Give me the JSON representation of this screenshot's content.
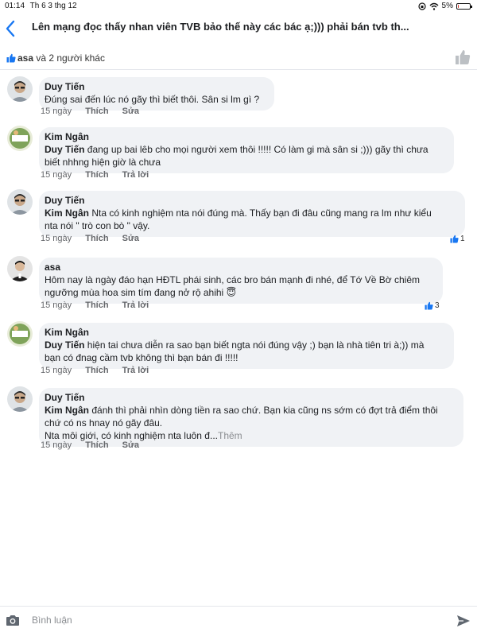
{
  "status_bar": {
    "time": "01:14",
    "date": "Th 6 3 thg 12",
    "battery": "5%",
    "battery_level": 0.05
  },
  "header": {
    "title": "Lên mạng đọc thấy nhan  viên TVB bảo thế này các bác ạ;))) phải bán tvb th..."
  },
  "likes": {
    "name": "asa",
    "others": " và 2 người khác"
  },
  "comments": [
    {
      "author": "Duy Tiến",
      "mention": "",
      "text": "Đúng sai đến lúc nó gãy thì biết thôi. Sân si lm gì ?",
      "time": "15 ngày",
      "like": "Thích",
      "action": "Sửa"
    },
    {
      "author": "Kim Ngân",
      "mention": "Duy Tiến",
      "line1": "  đang up bai lêb cho mọi người xem thôi !!!!! Có làm gi mà sân si ;))) gãy thì chưa",
      "line2": "biết nhhng hiện giờ là chưa",
      "time": "15 ngày",
      "like": "Thích",
      "action": "Trả lời"
    },
    {
      "author": "Duy Tiến",
      "mention": "Kim Ngân",
      "line1": "   Nta có kinh nghiệm nta nói đúng mà. Thấy bạn đi đâu cũng mang ra lm như kiểu",
      "line2": "nta nói \" trò con bò \" vậy.",
      "time": "15 ngày",
      "like": "Thích",
      "action": "Sửa",
      "reactions": "1"
    },
    {
      "author": "asa",
      "line1": "Hôm nay là ngày đáo hạn HĐTL phái sinh, các bro bán mạnh đi nhé, để Tớ Về Bờ chiêm",
      "line2": "ngưỡng mùa hoa sim tím đang nở rộ ahihi",
      "emoji": "😇",
      "time": "15 ngày",
      "like": "Thích",
      "action": "Trả lời",
      "reactions": "3"
    },
    {
      "author": "Kim Ngân",
      "mention": "Duy Tiến",
      "line1": "  hiện tai chưa diễn ra sao bạn biết ngta nói đúng vậy ;) bạn là nhà tiên tri à;)) mà",
      "line2": "bạn có đnag cầm tvb không thì bạn bán đi !!!!!",
      "time": "15 ngày",
      "like": "Thích",
      "action": "Trả lời"
    },
    {
      "author": "Duy Tiến",
      "mention": "Kim Ngân",
      "line1": "   đánh thì phải nhìn dòng tiền ra sao chứ. Bạn kia cũng ns sớm có đợt trả điểm thôi",
      "line2": "chứ có ns hnay nó gãy đâu.",
      "line3": "Nta môi giới, có kinh nghiệm nta luôn đ...",
      "more": "Thêm",
      "time": "15 ngày",
      "like": "Thích",
      "action": "Sửa"
    }
  ],
  "composer": {
    "placeholder": "Bình luận"
  },
  "colors": {
    "accent": "#1877f2",
    "bubble": "#f0f2f5",
    "meta": "#65676b"
  },
  "icons": [
    "back-icon",
    "wifi-icon",
    "battery-icon",
    "like-icon",
    "camera-icon",
    "send-icon"
  ]
}
